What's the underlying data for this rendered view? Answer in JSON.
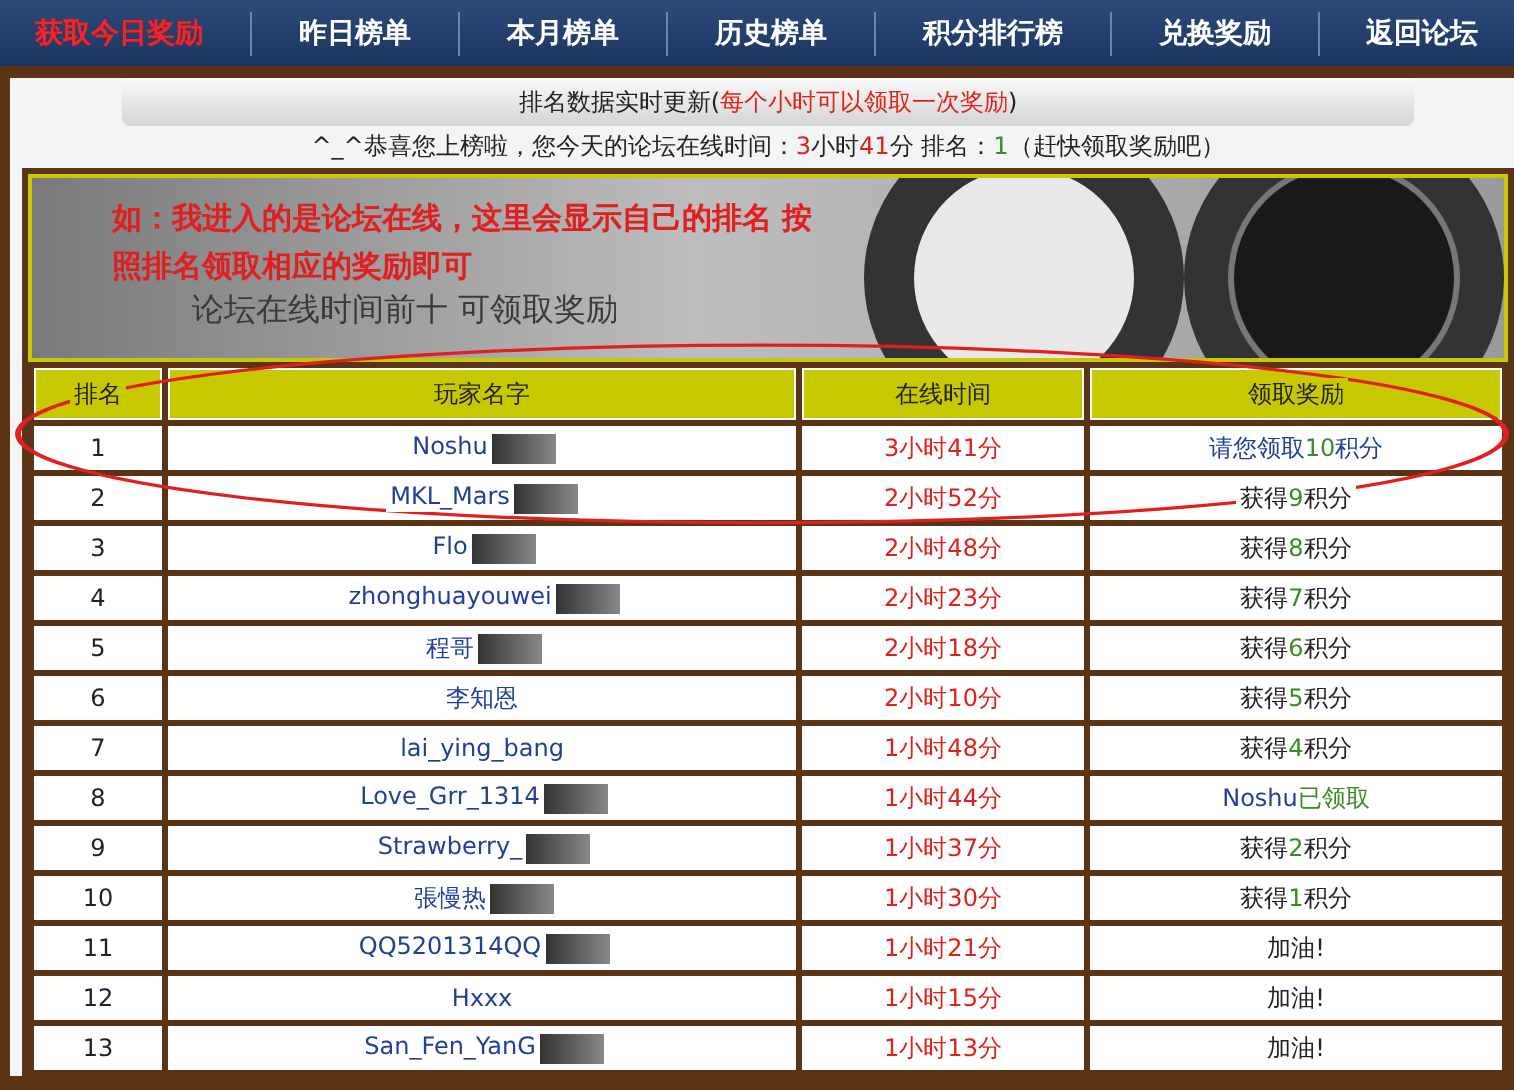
{
  "nav": [
    {
      "label": "获取今日奖励",
      "selected": true
    },
    {
      "label": "昨日榜单",
      "selected": false
    },
    {
      "label": "本月榜单",
      "selected": false
    },
    {
      "label": "历史榜单",
      "selected": false
    },
    {
      "label": "积分排行榜",
      "selected": false
    },
    {
      "label": "兑换奖励",
      "selected": false
    },
    {
      "label": "返回论坛",
      "selected": false
    }
  ],
  "notice": [
    {
      "kind": "text",
      "text": "排名数据实时更新("
    },
    {
      "kind": "alert",
      "text": "每个小时可以领取一次奖励"
    },
    {
      "kind": "text",
      "text": ")"
    }
  ],
  "status_line": [
    {
      "kind": "text",
      "text": "^_^恭喜您上榜啦，您今天的论坛在线时间："
    },
    {
      "kind": "alert",
      "text": "3"
    },
    {
      "kind": "text",
      "text": "小时"
    },
    {
      "kind": "alert",
      "text": "41"
    },
    {
      "kind": "text",
      "text": "分 排名："
    },
    {
      "kind": "points",
      "text": "1"
    },
    {
      "kind": "text",
      "text": "（赶快领取奖励吧）"
    }
  ],
  "banner": {
    "annotation": "如：我进入的是论坛在线，这里会显示自己的排名 按照排名领取相应的奖励即可",
    "caption": "论坛在线时间前十 可领取奖励"
  },
  "table": {
    "columns": [
      "排名",
      "玩家名字",
      "在线时间",
      "领取奖励"
    ],
    "rows": [
      {
        "rank": "1",
        "name": "Noshu",
        "badge": true,
        "time": "3小时41分",
        "reward": [
          {
            "kind": "name",
            "text": "请您领取"
          },
          {
            "kind": "points",
            "text": "10"
          },
          {
            "kind": "name",
            "text": "积分"
          }
        ]
      },
      {
        "rank": "2",
        "name": "MKL_Mars",
        "badge": true,
        "time": "2小时52分",
        "reward": [
          {
            "kind": "text",
            "text": "获得"
          },
          {
            "kind": "points",
            "text": "9"
          },
          {
            "kind": "text",
            "text": "积分"
          }
        ]
      },
      {
        "rank": "3",
        "name": "Flo",
        "badge": true,
        "time": "2小时48分",
        "reward": [
          {
            "kind": "text",
            "text": "获得"
          },
          {
            "kind": "points",
            "text": "8"
          },
          {
            "kind": "text",
            "text": "积分"
          }
        ]
      },
      {
        "rank": "4",
        "name": "zhonghuayouwei",
        "badge": true,
        "time": "2小时23分",
        "reward": [
          {
            "kind": "text",
            "text": "获得"
          },
          {
            "kind": "points",
            "text": "7"
          },
          {
            "kind": "text",
            "text": "积分"
          }
        ]
      },
      {
        "rank": "5",
        "name": "程哥",
        "badge": true,
        "time": "2小时18分",
        "reward": [
          {
            "kind": "text",
            "text": "获得"
          },
          {
            "kind": "points",
            "text": "6"
          },
          {
            "kind": "text",
            "text": "积分"
          }
        ]
      },
      {
        "rank": "6",
        "name": "李知恩",
        "badge": false,
        "time": "2小时10分",
        "reward": [
          {
            "kind": "text",
            "text": "获得"
          },
          {
            "kind": "points",
            "text": "5"
          },
          {
            "kind": "text",
            "text": "积分"
          }
        ]
      },
      {
        "rank": "7",
        "name": "lai_ying_bang",
        "badge": false,
        "time": "1小时48分",
        "reward": [
          {
            "kind": "text",
            "text": "获得"
          },
          {
            "kind": "points",
            "text": "4"
          },
          {
            "kind": "text",
            "text": "积分"
          }
        ]
      },
      {
        "rank": "8",
        "name": "Love_Grr_1314",
        "badge": true,
        "time": "1小时44分",
        "reward": [
          {
            "kind": "name",
            "text": "Noshu"
          },
          {
            "kind": "points",
            "text": "已领取"
          }
        ]
      },
      {
        "rank": "9",
        "name": "Strawberry_",
        "badge": true,
        "time": "1小时37分",
        "reward": [
          {
            "kind": "text",
            "text": "获得"
          },
          {
            "kind": "points",
            "text": "2"
          },
          {
            "kind": "text",
            "text": "积分"
          }
        ]
      },
      {
        "rank": "10",
        "name": "張慢热",
        "badge": true,
        "time": "1小时30分",
        "reward": [
          {
            "kind": "text",
            "text": "获得"
          },
          {
            "kind": "points",
            "text": "1"
          },
          {
            "kind": "text",
            "text": "积分"
          }
        ]
      },
      {
        "rank": "11",
        "name": "QQ5201314QQ",
        "badge": true,
        "time": "1小时21分",
        "reward": [
          {
            "kind": "text",
            "text": "加油!"
          }
        ]
      },
      {
        "rank": "12",
        "name": "Hxxx",
        "badge": false,
        "time": "1小时15分",
        "reward": [
          {
            "kind": "text",
            "text": "加油!"
          }
        ]
      },
      {
        "rank": "13",
        "name": "San_Fen_YanG",
        "badge": true,
        "time": "1小时13分",
        "reward": [
          {
            "kind": "text",
            "text": "加油!"
          }
        ]
      }
    ]
  }
}
